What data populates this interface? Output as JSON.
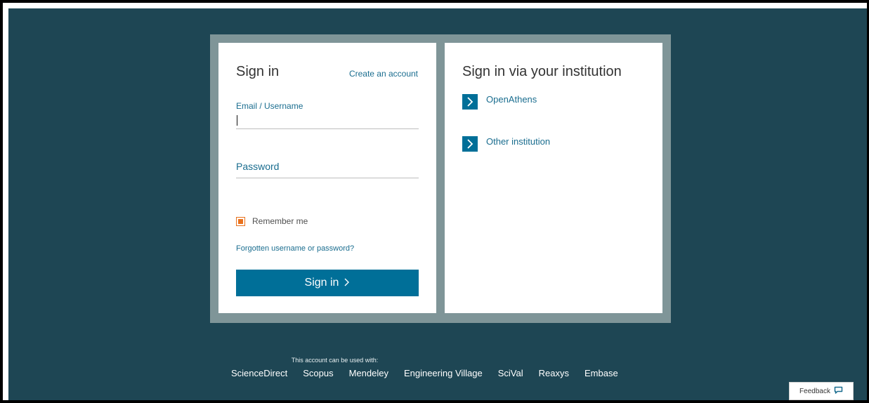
{
  "signin": {
    "title": "Sign in",
    "create_account": "Create an account",
    "email_label": "Email / Username",
    "email_value": "",
    "password_label": "Password",
    "password_value": "",
    "remember_label": "Remember me",
    "remember_checked": true,
    "forgot_link": "Forgotten username or password?",
    "button_label": "Sign in"
  },
  "institution": {
    "title": "Sign in via your institution",
    "options": [
      {
        "label": "OpenAthens",
        "icon": "chevron-right-icon"
      },
      {
        "label": "Other institution",
        "icon": "chevron-right-icon"
      }
    ]
  },
  "footer": {
    "note": "This account can be used with:",
    "products": [
      "ScienceDirect",
      "Scopus",
      "Mendeley",
      "Engineering Village",
      "SciVal",
      "Reaxys",
      "Embase"
    ]
  },
  "feedback": {
    "label": "Feedback",
    "icon": "speech-bubble-icon"
  },
  "colors": {
    "background": "#1e4654",
    "panel_border": "#7f9598",
    "link": "#1a6d8f",
    "button": "#006f98",
    "checkbox": "#e9711c"
  }
}
